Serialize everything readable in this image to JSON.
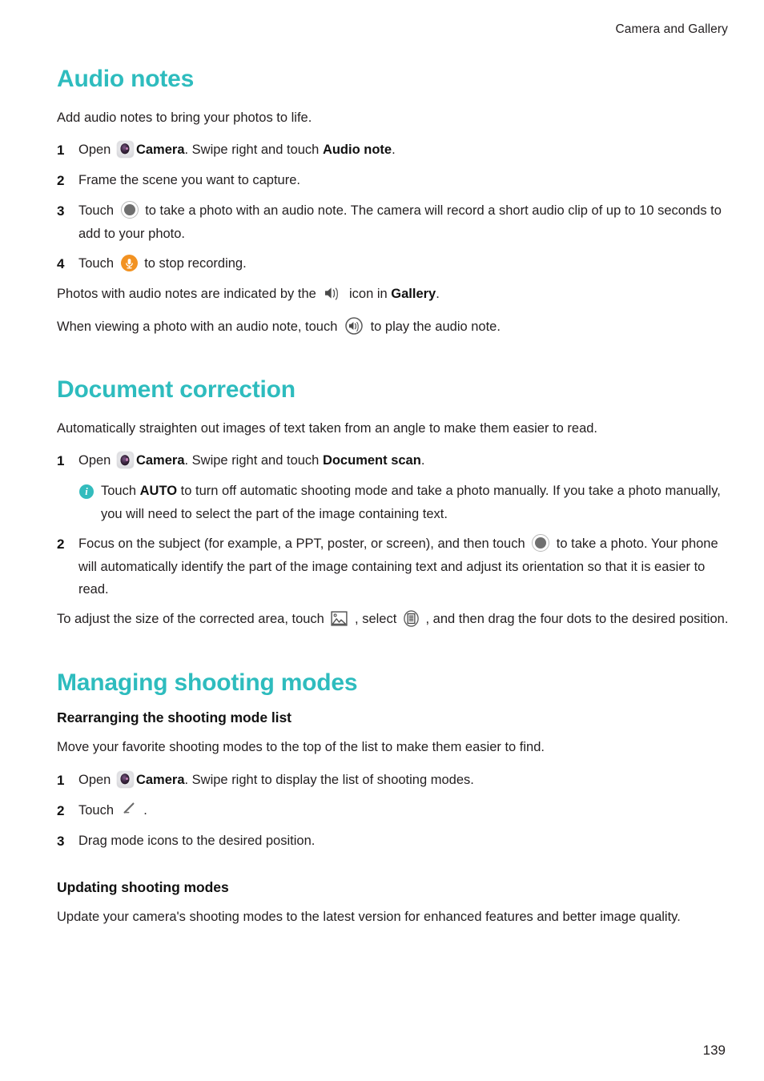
{
  "running_head": "Camera and Gallery",
  "page_number": "139",
  "theme": {
    "heading_color": "#2ebcbe",
    "body_color": "#231f20",
    "mic_accent": "#f29222",
    "info_badge": "#33bcbd"
  },
  "sections": [
    {
      "id": "audio-notes",
      "heading": "Audio notes",
      "intro": "Add audio notes to bring your photos to life.",
      "steps": [
        {
          "num": "1",
          "parts": [
            {
              "t": "text",
              "v": "Open "
            },
            {
              "t": "icon",
              "v": "camera-icon"
            },
            {
              "t": "bold",
              "v": "Camera"
            },
            {
              "t": "text",
              "v": ". Swipe right and touch "
            },
            {
              "t": "bold",
              "v": "Audio note"
            },
            {
              "t": "text",
              "v": "."
            }
          ]
        },
        {
          "num": "2",
          "parts": [
            {
              "t": "text",
              "v": "Frame the scene you want to capture."
            }
          ]
        },
        {
          "num": "3",
          "parts": [
            {
              "t": "text",
              "v": "Touch "
            },
            {
              "t": "icon",
              "v": "shutter-icon"
            },
            {
              "t": "text",
              "v": " to take a photo with an audio note. The camera will record a short audio clip of up to 10 seconds to add to your photo."
            }
          ]
        },
        {
          "num": "4",
          "parts": [
            {
              "t": "text",
              "v": "Touch "
            },
            {
              "t": "icon",
              "v": "microphone-icon"
            },
            {
              "t": "text",
              "v": " to stop recording."
            }
          ]
        }
      ],
      "trailing": [
        {
          "parts": [
            {
              "t": "text",
              "v": "Photos with audio notes are indicated by the "
            },
            {
              "t": "icon",
              "v": "speaker-icon"
            },
            {
              "t": "text",
              "v": " icon in "
            },
            {
              "t": "bold",
              "v": "Gallery"
            },
            {
              "t": "text",
              "v": "."
            }
          ]
        },
        {
          "parts": [
            {
              "t": "text",
              "v": "When viewing a photo with an audio note, touch "
            },
            {
              "t": "icon",
              "v": "speaker-circle-icon"
            },
            {
              "t": "text",
              "v": " to play the audio note."
            }
          ]
        }
      ]
    },
    {
      "id": "document-correction",
      "heading": "Document correction",
      "intro": "Automatically straighten out images of text taken from an angle to make them easier to read.",
      "steps": [
        {
          "num": "1",
          "parts": [
            {
              "t": "text",
              "v": "Open "
            },
            {
              "t": "icon",
              "v": "camera-icon"
            },
            {
              "t": "bold",
              "v": "Camera"
            },
            {
              "t": "text",
              "v": ". Swipe right and touch "
            },
            {
              "t": "bold",
              "v": "Document scan"
            },
            {
              "t": "text",
              "v": "."
            }
          ],
          "note": {
            "icon": "info-icon",
            "parts": [
              {
                "t": "text",
                "v": "Touch "
              },
              {
                "t": "bold",
                "v": "AUTO"
              },
              {
                "t": "text",
                "v": " to turn off automatic shooting mode and take a photo manually. If you take a photo manually, you will need to select the part of the image containing text."
              }
            ]
          }
        },
        {
          "num": "2",
          "parts": [
            {
              "t": "text",
              "v": "Focus on the subject (for example, a PPT, poster, or screen), and then touch "
            },
            {
              "t": "icon",
              "v": "shutter-icon"
            },
            {
              "t": "text",
              "v": " to take a photo. Your phone will automatically identify the part of the image containing text and adjust its orientation so that it is easier to read."
            }
          ]
        }
      ],
      "trailing": [
        {
          "parts": [
            {
              "t": "text",
              "v": "To adjust the size of the corrected area, touch "
            },
            {
              "t": "icon",
              "v": "picture-icon"
            },
            {
              "t": "text",
              "v": " , select "
            },
            {
              "t": "icon",
              "v": "list-icon"
            },
            {
              "t": "text",
              "v": " , and then drag the four dots to the desired position."
            }
          ]
        }
      ]
    },
    {
      "id": "managing-shooting-modes",
      "heading": "Managing shooting modes",
      "subsections": [
        {
          "id": "rearranging",
          "subheading": "Rearranging the shooting mode list",
          "intro": "Move your favorite shooting modes to the top of the list to make them easier to find.",
          "steps": [
            {
              "num": "1",
              "parts": [
                {
                  "t": "text",
                  "v": "Open "
                },
                {
                  "t": "icon",
                  "v": "camera-icon"
                },
                {
                  "t": "bold",
                  "v": "Camera"
                },
                {
                  "t": "text",
                  "v": ". Swipe right to display the list of shooting modes."
                }
              ]
            },
            {
              "num": "2",
              "parts": [
                {
                  "t": "text",
                  "v": "Touch "
                },
                {
                  "t": "icon",
                  "v": "pencil-icon"
                },
                {
                  "t": "text",
                  "v": " ."
                }
              ]
            },
            {
              "num": "3",
              "parts": [
                {
                  "t": "text",
                  "v": "Drag mode icons to the desired position."
                }
              ]
            }
          ]
        },
        {
          "id": "updating",
          "subheading": "Updating shooting modes",
          "intro": "Update your camera's shooting modes to the latest version for enhanced features and better image quality.",
          "steps": []
        }
      ]
    }
  ]
}
